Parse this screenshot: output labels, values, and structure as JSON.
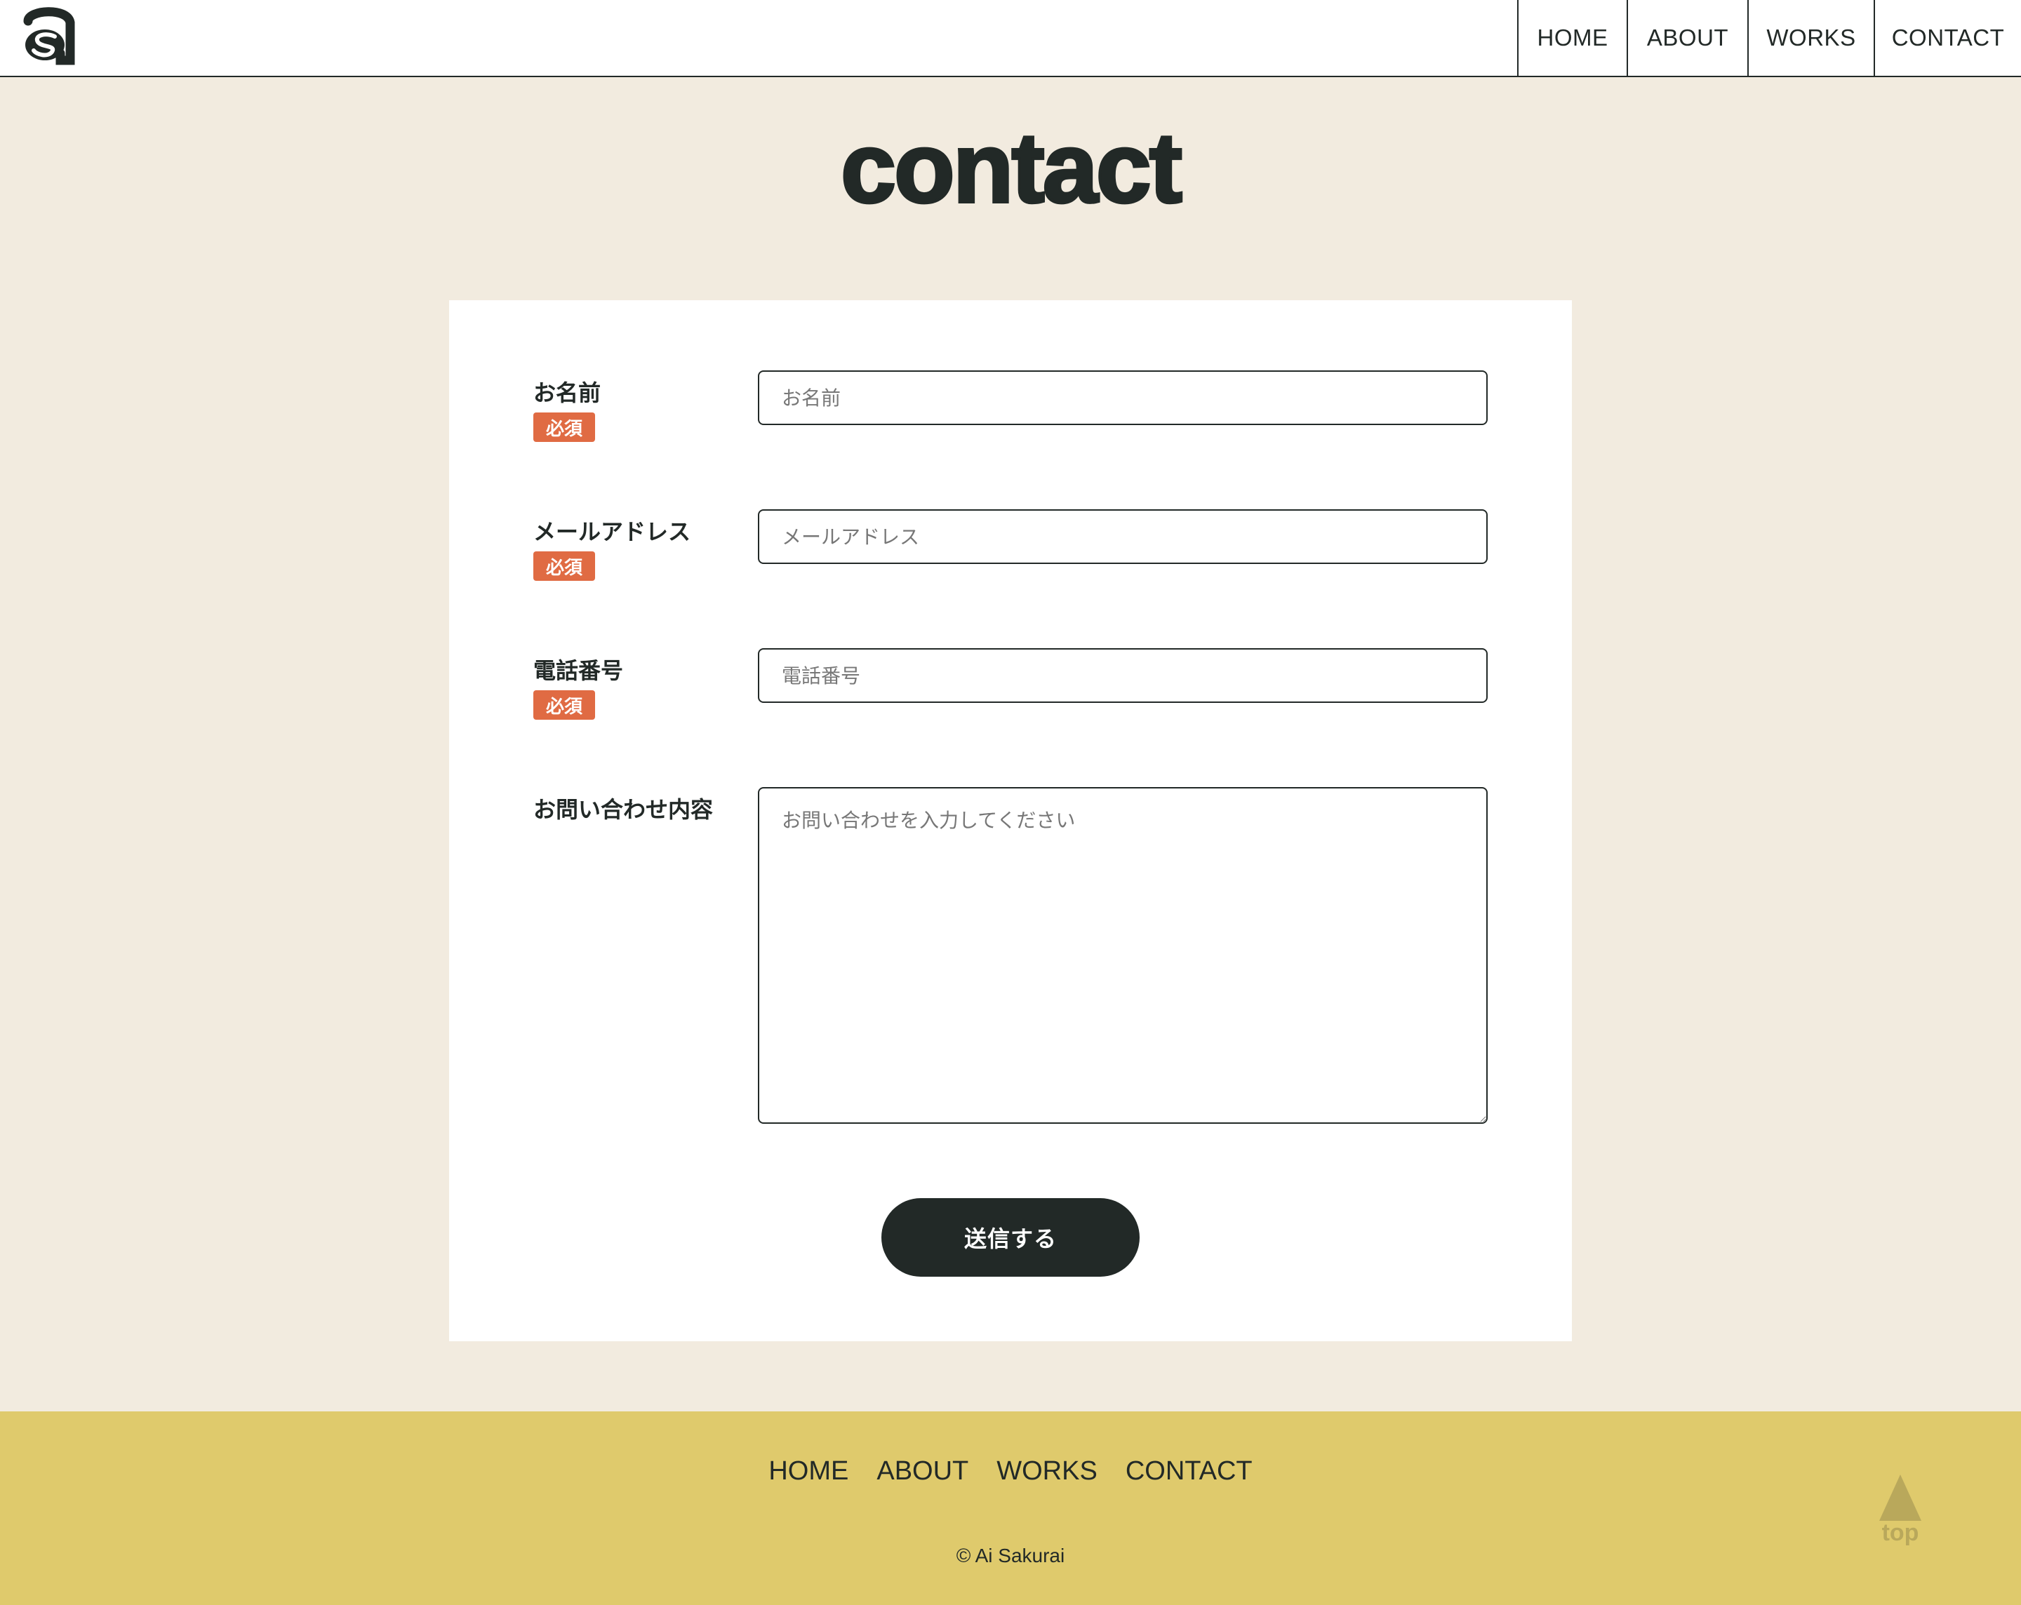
{
  "header": {
    "nav": [
      {
        "label": "HOME"
      },
      {
        "label": "ABOUT"
      },
      {
        "label": "WORKS"
      },
      {
        "label": "CONTACT"
      }
    ]
  },
  "page": {
    "title": "contact"
  },
  "form": {
    "name": {
      "label": "お名前",
      "required": "必須",
      "placeholder": "お名前"
    },
    "email": {
      "label": "メールアドレス",
      "required": "必須",
      "placeholder": "メールアドレス"
    },
    "phone": {
      "label": "電話番号",
      "required": "必須",
      "placeholder": "電話番号"
    },
    "message": {
      "label": "お問い合わせ内容",
      "placeholder": "お問い合わせを入力してください"
    },
    "submit_label": "送信する"
  },
  "footer": {
    "nav": [
      {
        "label": "HOME"
      },
      {
        "label": "ABOUT"
      },
      {
        "label": "WORKS"
      },
      {
        "label": "CONTACT"
      }
    ],
    "copyright": "© Ai Sakurai",
    "to_top_label": "top"
  },
  "colors": {
    "background": "#f2ebdf",
    "text": "#222927",
    "required_badge": "#e06b43",
    "footer": "#dfca6c",
    "to_top": "#b9a85b"
  },
  "icons": {
    "logo": "as-monogram-logo",
    "to_top": "up-triangle-icon"
  }
}
